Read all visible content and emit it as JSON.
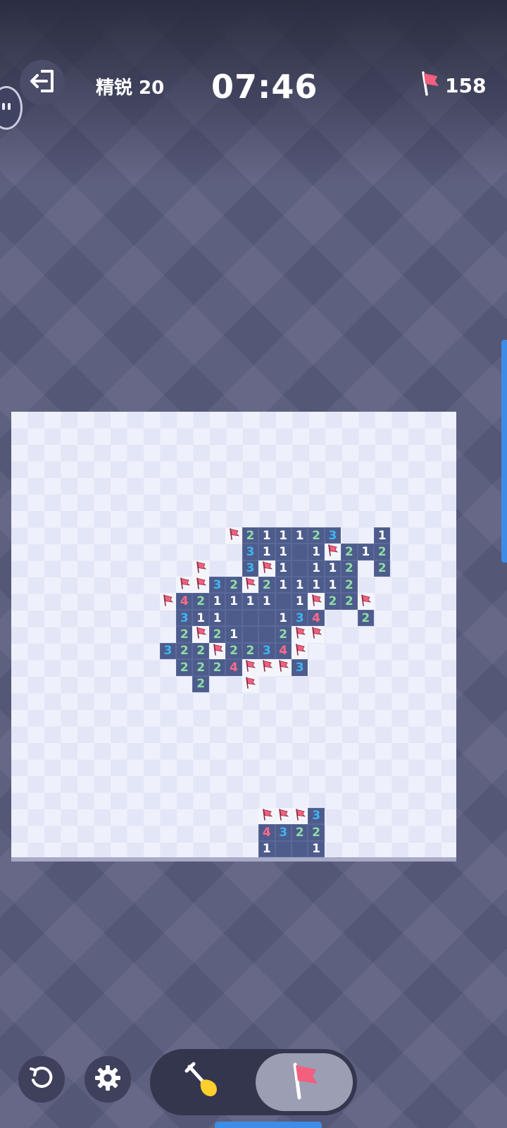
{
  "header": {
    "level_label": "精锐 20",
    "timer": "07:46",
    "flags_remaining": "158"
  },
  "icons": {
    "exit": "exit-icon",
    "bubble": "chat-bubble-icon",
    "flag": "flag-icon",
    "restart": "restart-icon",
    "settings": "gear-icon",
    "dig": "shovel-icon",
    "flag_mode": "flag-mode-icon"
  },
  "colors": {
    "open_cell": "#4e5c8c",
    "n1": "#ffffff",
    "n2": "#8fdca6",
    "n3": "#3fb4f2",
    "n4": "#ff6a8a",
    "flag": "#f2607d",
    "accent": "#3d8de8"
  },
  "board": {
    "cols": 27,
    "rows": 27,
    "cells": [
      {
        "r": 7,
        "c": 13,
        "v": "F"
      },
      {
        "r": 7,
        "c": 14,
        "v": "2"
      },
      {
        "r": 7,
        "c": 15,
        "v": "1"
      },
      {
        "r": 7,
        "c": 16,
        "v": "1"
      },
      {
        "r": 7,
        "c": 17,
        "v": "1"
      },
      {
        "r": 7,
        "c": 18,
        "v": "2"
      },
      {
        "r": 7,
        "c": 19,
        "v": "3"
      },
      {
        "r": 7,
        "c": 22,
        "v": "1"
      },
      {
        "r": 8,
        "c": 14,
        "v": "3"
      },
      {
        "r": 8,
        "c": 15,
        "v": "1"
      },
      {
        "r": 8,
        "c": 16,
        "v": "1"
      },
      {
        "r": 8,
        "c": 17,
        "v": ""
      },
      {
        "r": 8,
        "c": 18,
        "v": "1"
      },
      {
        "r": 8,
        "c": 19,
        "v": "F"
      },
      {
        "r": 8,
        "c": 20,
        "v": "2"
      },
      {
        "r": 8,
        "c": 21,
        "v": "1"
      },
      {
        "r": 8,
        "c": 22,
        "v": "2"
      },
      {
        "r": 9,
        "c": 11,
        "v": "F"
      },
      {
        "r": 9,
        "c": 14,
        "v": "3"
      },
      {
        "r": 9,
        "c": 15,
        "v": "F"
      },
      {
        "r": 9,
        "c": 16,
        "v": "1"
      },
      {
        "r": 9,
        "c": 17,
        "v": ""
      },
      {
        "r": 9,
        "c": 18,
        "v": "1"
      },
      {
        "r": 9,
        "c": 19,
        "v": "1"
      },
      {
        "r": 9,
        "c": 20,
        "v": "2"
      },
      {
        "r": 9,
        "c": 22,
        "v": "2"
      },
      {
        "r": 10,
        "c": 10,
        "v": "F"
      },
      {
        "r": 10,
        "c": 11,
        "v": "F"
      },
      {
        "r": 10,
        "c": 12,
        "v": "3"
      },
      {
        "r": 10,
        "c": 13,
        "v": "2"
      },
      {
        "r": 10,
        "c": 14,
        "v": "F"
      },
      {
        "r": 10,
        "c": 15,
        "v": "2"
      },
      {
        "r": 10,
        "c": 16,
        "v": "1"
      },
      {
        "r": 10,
        "c": 17,
        "v": "1"
      },
      {
        "r": 10,
        "c": 18,
        "v": "1"
      },
      {
        "r": 10,
        "c": 19,
        "v": "1"
      },
      {
        "r": 10,
        "c": 20,
        "v": "2"
      },
      {
        "r": 11,
        "c": 9,
        "v": "F"
      },
      {
        "r": 11,
        "c": 10,
        "v": "4"
      },
      {
        "r": 11,
        "c": 11,
        "v": "2"
      },
      {
        "r": 11,
        "c": 12,
        "v": "1"
      },
      {
        "r": 11,
        "c": 13,
        "v": "1"
      },
      {
        "r": 11,
        "c": 14,
        "v": "1"
      },
      {
        "r": 11,
        "c": 15,
        "v": "1"
      },
      {
        "r": 11,
        "c": 16,
        "v": ""
      },
      {
        "r": 11,
        "c": 17,
        "v": "1"
      },
      {
        "r": 11,
        "c": 18,
        "v": "F"
      },
      {
        "r": 11,
        "c": 19,
        "v": "2"
      },
      {
        "r": 11,
        "c": 20,
        "v": "2"
      },
      {
        "r": 11,
        "c": 21,
        "v": "F"
      },
      {
        "r": 12,
        "c": 10,
        "v": "3"
      },
      {
        "r": 12,
        "c": 11,
        "v": "1"
      },
      {
        "r": 12,
        "c": 12,
        "v": "1"
      },
      {
        "r": 12,
        "c": 13,
        "v": ""
      },
      {
        "r": 12,
        "c": 14,
        "v": ""
      },
      {
        "r": 12,
        "c": 15,
        "v": ""
      },
      {
        "r": 12,
        "c": 16,
        "v": "1"
      },
      {
        "r": 12,
        "c": 17,
        "v": "3"
      },
      {
        "r": 12,
        "c": 18,
        "v": "4"
      },
      {
        "r": 12,
        "c": 21,
        "v": "2"
      },
      {
        "r": 13,
        "c": 10,
        "v": "2"
      },
      {
        "r": 13,
        "c": 11,
        "v": "F"
      },
      {
        "r": 13,
        "c": 12,
        "v": "2"
      },
      {
        "r": 13,
        "c": 13,
        "v": "1"
      },
      {
        "r": 13,
        "c": 14,
        "v": ""
      },
      {
        "r": 13,
        "c": 15,
        "v": ""
      },
      {
        "r": 13,
        "c": 16,
        "v": "2"
      },
      {
        "r": 13,
        "c": 17,
        "v": "F"
      },
      {
        "r": 13,
        "c": 18,
        "v": "F"
      },
      {
        "r": 14,
        "c": 9,
        "v": "3"
      },
      {
        "r": 14,
        "c": 10,
        "v": "2"
      },
      {
        "r": 14,
        "c": 11,
        "v": "2"
      },
      {
        "r": 14,
        "c": 12,
        "v": "F"
      },
      {
        "r": 14,
        "c": 13,
        "v": "2"
      },
      {
        "r": 14,
        "c": 14,
        "v": "2"
      },
      {
        "r": 14,
        "c": 15,
        "v": "3"
      },
      {
        "r": 14,
        "c": 16,
        "v": "4"
      },
      {
        "r": 14,
        "c": 17,
        "v": "F"
      },
      {
        "r": 15,
        "c": 10,
        "v": "2"
      },
      {
        "r": 15,
        "c": 11,
        "v": "2"
      },
      {
        "r": 15,
        "c": 12,
        "v": "2"
      },
      {
        "r": 15,
        "c": 13,
        "v": "4"
      },
      {
        "r": 15,
        "c": 14,
        "v": "F"
      },
      {
        "r": 15,
        "c": 15,
        "v": "F"
      },
      {
        "r": 15,
        "c": 16,
        "v": "F"
      },
      {
        "r": 15,
        "c": 17,
        "v": "3"
      },
      {
        "r": 16,
        "c": 11,
        "v": "2"
      },
      {
        "r": 16,
        "c": 14,
        "v": "F"
      },
      {
        "r": 24,
        "c": 15,
        "v": "F"
      },
      {
        "r": 24,
        "c": 16,
        "v": "F"
      },
      {
        "r": 24,
        "c": 17,
        "v": "F"
      },
      {
        "r": 24,
        "c": 18,
        "v": "3"
      },
      {
        "r": 25,
        "c": 15,
        "v": "4"
      },
      {
        "r": 25,
        "c": 16,
        "v": "3"
      },
      {
        "r": 25,
        "c": 17,
        "v": "2"
      },
      {
        "r": 25,
        "c": 18,
        "v": "2"
      },
      {
        "r": 26,
        "c": 15,
        "v": "1"
      },
      {
        "r": 26,
        "c": 16,
        "v": ""
      },
      {
        "r": 26,
        "c": 17,
        "v": ""
      },
      {
        "r": 26,
        "c": 18,
        "v": "1"
      }
    ]
  }
}
